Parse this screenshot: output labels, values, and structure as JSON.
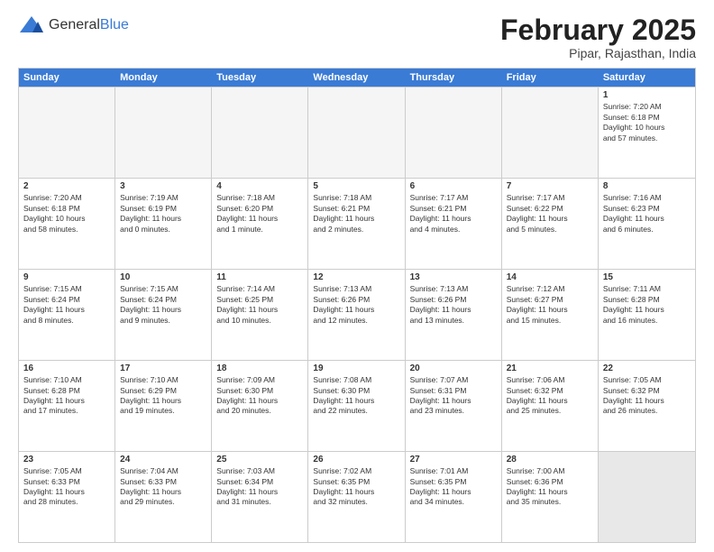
{
  "header": {
    "logo_general": "General",
    "logo_blue": "Blue",
    "month_year": "February 2025",
    "location": "Pipar, Rajasthan, India"
  },
  "weekdays": [
    "Sunday",
    "Monday",
    "Tuesday",
    "Wednesday",
    "Thursday",
    "Friday",
    "Saturday"
  ],
  "rows": [
    [
      {
        "day": "",
        "info": "",
        "empty": true
      },
      {
        "day": "",
        "info": "",
        "empty": true
      },
      {
        "day": "",
        "info": "",
        "empty": true
      },
      {
        "day": "",
        "info": "",
        "empty": true
      },
      {
        "day": "",
        "info": "",
        "empty": true
      },
      {
        "day": "",
        "info": "",
        "empty": true
      },
      {
        "day": "1",
        "info": "Sunrise: 7:20 AM\nSunset: 6:18 PM\nDaylight: 10 hours\nand 57 minutes."
      }
    ],
    [
      {
        "day": "2",
        "info": "Sunrise: 7:20 AM\nSunset: 6:18 PM\nDaylight: 10 hours\nand 58 minutes."
      },
      {
        "day": "3",
        "info": "Sunrise: 7:19 AM\nSunset: 6:19 PM\nDaylight: 11 hours\nand 0 minutes."
      },
      {
        "day": "4",
        "info": "Sunrise: 7:18 AM\nSunset: 6:20 PM\nDaylight: 11 hours\nand 1 minute."
      },
      {
        "day": "5",
        "info": "Sunrise: 7:18 AM\nSunset: 6:21 PM\nDaylight: 11 hours\nand 2 minutes."
      },
      {
        "day": "6",
        "info": "Sunrise: 7:17 AM\nSunset: 6:21 PM\nDaylight: 11 hours\nand 4 minutes."
      },
      {
        "day": "7",
        "info": "Sunrise: 7:17 AM\nSunset: 6:22 PM\nDaylight: 11 hours\nand 5 minutes."
      },
      {
        "day": "8",
        "info": "Sunrise: 7:16 AM\nSunset: 6:23 PM\nDaylight: 11 hours\nand 6 minutes."
      }
    ],
    [
      {
        "day": "9",
        "info": "Sunrise: 7:15 AM\nSunset: 6:24 PM\nDaylight: 11 hours\nand 8 minutes."
      },
      {
        "day": "10",
        "info": "Sunrise: 7:15 AM\nSunset: 6:24 PM\nDaylight: 11 hours\nand 9 minutes."
      },
      {
        "day": "11",
        "info": "Sunrise: 7:14 AM\nSunset: 6:25 PM\nDaylight: 11 hours\nand 10 minutes."
      },
      {
        "day": "12",
        "info": "Sunrise: 7:13 AM\nSunset: 6:26 PM\nDaylight: 11 hours\nand 12 minutes."
      },
      {
        "day": "13",
        "info": "Sunrise: 7:13 AM\nSunset: 6:26 PM\nDaylight: 11 hours\nand 13 minutes."
      },
      {
        "day": "14",
        "info": "Sunrise: 7:12 AM\nSunset: 6:27 PM\nDaylight: 11 hours\nand 15 minutes."
      },
      {
        "day": "15",
        "info": "Sunrise: 7:11 AM\nSunset: 6:28 PM\nDaylight: 11 hours\nand 16 minutes."
      }
    ],
    [
      {
        "day": "16",
        "info": "Sunrise: 7:10 AM\nSunset: 6:28 PM\nDaylight: 11 hours\nand 17 minutes."
      },
      {
        "day": "17",
        "info": "Sunrise: 7:10 AM\nSunset: 6:29 PM\nDaylight: 11 hours\nand 19 minutes."
      },
      {
        "day": "18",
        "info": "Sunrise: 7:09 AM\nSunset: 6:30 PM\nDaylight: 11 hours\nand 20 minutes."
      },
      {
        "day": "19",
        "info": "Sunrise: 7:08 AM\nSunset: 6:30 PM\nDaylight: 11 hours\nand 22 minutes."
      },
      {
        "day": "20",
        "info": "Sunrise: 7:07 AM\nSunset: 6:31 PM\nDaylight: 11 hours\nand 23 minutes."
      },
      {
        "day": "21",
        "info": "Sunrise: 7:06 AM\nSunset: 6:32 PM\nDaylight: 11 hours\nand 25 minutes."
      },
      {
        "day": "22",
        "info": "Sunrise: 7:05 AM\nSunset: 6:32 PM\nDaylight: 11 hours\nand 26 minutes."
      }
    ],
    [
      {
        "day": "23",
        "info": "Sunrise: 7:05 AM\nSunset: 6:33 PM\nDaylight: 11 hours\nand 28 minutes."
      },
      {
        "day": "24",
        "info": "Sunrise: 7:04 AM\nSunset: 6:33 PM\nDaylight: 11 hours\nand 29 minutes."
      },
      {
        "day": "25",
        "info": "Sunrise: 7:03 AM\nSunset: 6:34 PM\nDaylight: 11 hours\nand 31 minutes."
      },
      {
        "day": "26",
        "info": "Sunrise: 7:02 AM\nSunset: 6:35 PM\nDaylight: 11 hours\nand 32 minutes."
      },
      {
        "day": "27",
        "info": "Sunrise: 7:01 AM\nSunset: 6:35 PM\nDaylight: 11 hours\nand 34 minutes."
      },
      {
        "day": "28",
        "info": "Sunrise: 7:00 AM\nSunset: 6:36 PM\nDaylight: 11 hours\nand 35 minutes."
      },
      {
        "day": "",
        "info": "",
        "empty": true,
        "shaded": true
      }
    ]
  ]
}
